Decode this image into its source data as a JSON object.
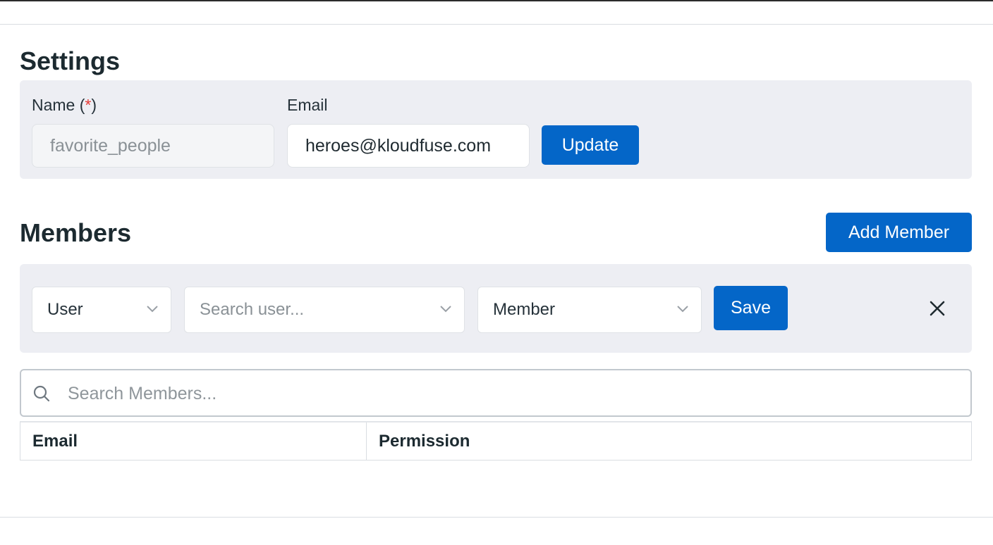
{
  "settings": {
    "title": "Settings",
    "name_label": "Name (",
    "name_required_mark": "*",
    "name_label_close": ")",
    "name_value": "favorite_people",
    "email_label": "Email",
    "email_value": "heroes@kloudfuse.com",
    "update_label": "Update"
  },
  "members": {
    "title": "Members",
    "add_member_label": "Add Member",
    "add_row": {
      "type_select": "User",
      "user_select_placeholder": "Search user...",
      "permission_select": "Member",
      "save_label": "Save"
    },
    "search_placeholder": "Search Members...",
    "table": {
      "columns": [
        "Email",
        "Permission"
      ]
    }
  },
  "colors": {
    "primary": "#0466c8",
    "panel_bg": "#edeef3",
    "required": "#e53935"
  }
}
